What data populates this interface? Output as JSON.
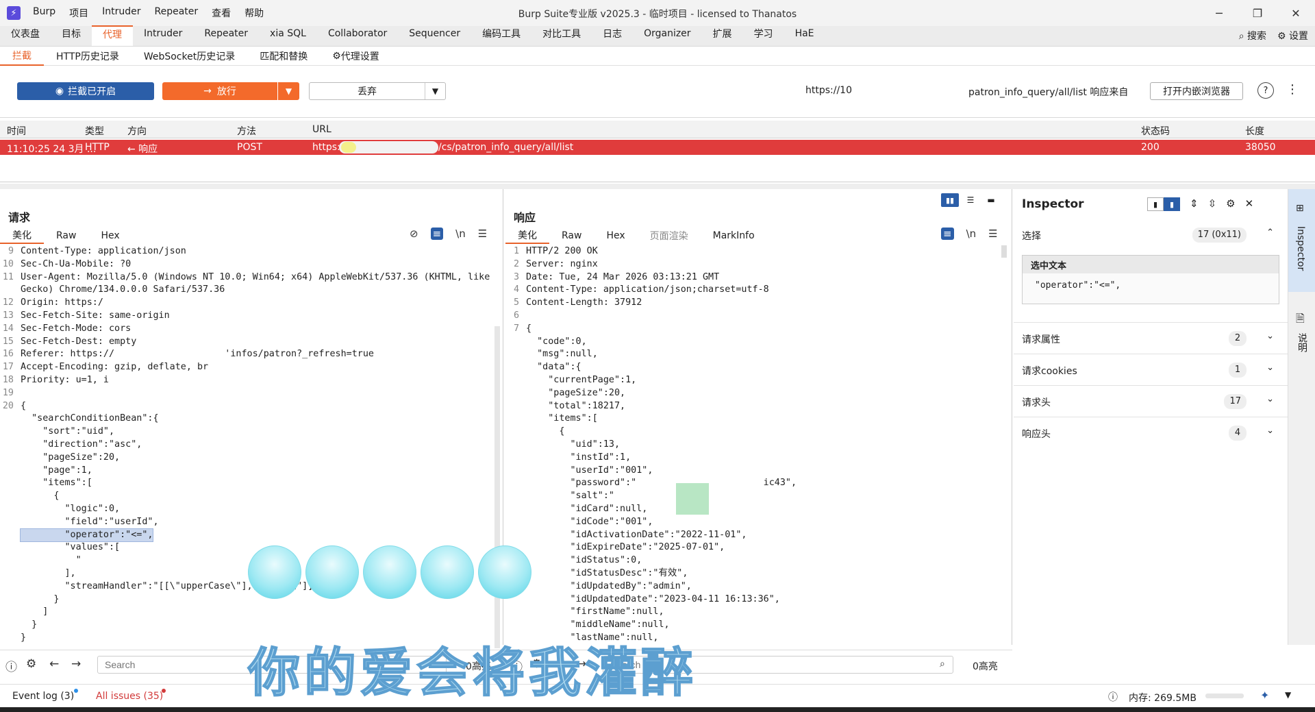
{
  "window": {
    "title": "Burp Suite专业版  v2025.3 - 临时项目 - licensed to Thanatos",
    "menu": [
      "Burp",
      "项目",
      "Intruder",
      "Repeater",
      "查看",
      "帮助"
    ],
    "controls": [
      "─",
      "❐",
      "✕"
    ]
  },
  "main_tabs": [
    "仪表盘",
    "目标",
    "代理",
    "Intruder",
    "Repeater",
    "xia SQL",
    "Collaborator",
    "Sequencer",
    "编码工具",
    "对比工具",
    "日志",
    "Organizer",
    "扩展",
    "学习",
    "HaE"
  ],
  "main_tab_active": "代理",
  "top_right": {
    "search": "搜索",
    "settings": "设置"
  },
  "sub_tabs": [
    "拦截",
    "HTTP历史记录",
    "WebSocket历史记录",
    "匹配和替换",
    "代理设置"
  ],
  "toolbar": {
    "intercept": "拦截已开启",
    "forward": "放行",
    "drop": "丢弃",
    "url": "https://10",
    "response_from": "patron_info_query/all/list 响应来自",
    "open_browser": "打开内嵌浏览器",
    "help": "?",
    "more": "⋮"
  },
  "table": {
    "headers": [
      "时间",
      "类型",
      "方向",
      "方法",
      "URL",
      "状态码",
      "长度"
    ],
    "row": {
      "time": "11:10:25 24 3月 ...",
      "type": "HTTP",
      "direction": "← 响应",
      "method": "POST",
      "url_prefix": "https:/",
      "url_suffix": "/cs/patron_info_query/all/list",
      "status": "200",
      "length": "38050"
    }
  },
  "request": {
    "title": "请求",
    "tabs": [
      "美化",
      "Raw",
      "Hex"
    ],
    "lines": [
      {
        "n": "9",
        "t": "Content-Type: application/json"
      },
      {
        "n": "10",
        "t": "Sec-Ch-Ua-Mobile: ?0"
      },
      {
        "n": "11",
        "t": "User-Agent: Mozilla/5.0 (Windows NT 10.0; Win64; x64) AppleWebKit/537.36 (KHTML, like"
      },
      {
        "n": "",
        "t": "Gecko) Chrome/134.0.0.0 Safari/537.36"
      },
      {
        "n": "12",
        "t": "Origin: https:/"
      },
      {
        "n": "13",
        "t": "Sec-Fetch-Site: same-origin"
      },
      {
        "n": "14",
        "t": "Sec-Fetch-Mode: cors"
      },
      {
        "n": "15",
        "t": "Sec-Fetch-Dest: empty"
      },
      {
        "n": "16",
        "t": "Referer: https://                    'infos/patron?_refresh=true"
      },
      {
        "n": "17",
        "t": "Accept-Encoding: gzip, deflate, br"
      },
      {
        "n": "18",
        "t": "Priority: u=1, i"
      },
      {
        "n": "19",
        "t": ""
      },
      {
        "n": "20",
        "t": "{"
      },
      {
        "n": "",
        "t": "  \"searchConditionBean\":{"
      },
      {
        "n": "",
        "t": "    \"sort\":\"uid\","
      },
      {
        "n": "",
        "t": "    \"direction\":\"asc\","
      },
      {
        "n": "",
        "t": "    \"pageSize\":20,"
      },
      {
        "n": "",
        "t": "    \"page\":1,"
      },
      {
        "n": "",
        "t": "    \"items\":["
      },
      {
        "n": "",
        "t": "      {"
      },
      {
        "n": "",
        "t": "        \"logic\":0,"
      },
      {
        "n": "",
        "t": "        \"field\":\"userId\","
      },
      {
        "n": "",
        "t": "        \"operator\":\"<=\","
      },
      {
        "n": "",
        "t": "        \"values\":["
      },
      {
        "n": "",
        "t": "          \""
      },
      {
        "n": "",
        "t": "        ],"
      },
      {
        "n": "",
        "t": "        \"streamHandler\":\"[[\\\"upperCase\\\"],[\\\"trim\\\"]]\""
      },
      {
        "n": "",
        "t": "      }"
      },
      {
        "n": "",
        "t": "    ]"
      },
      {
        "n": "",
        "t": "  }"
      },
      {
        "n": "",
        "t": "}"
      }
    ]
  },
  "response": {
    "title": "响应",
    "tabs": [
      "美化",
      "Raw",
      "Hex",
      "页面渲染",
      "MarkInfo"
    ],
    "lines": [
      {
        "n": "1",
        "t": "HTTP/2 200 OK"
      },
      {
        "n": "2",
        "t": "Server: nginx"
      },
      {
        "n": "3",
        "t": "Date: Tue, 24 Mar 2026 03:13:21 GMT"
      },
      {
        "n": "4",
        "t": "Content-Type: application/json;charset=utf-8"
      },
      {
        "n": "5",
        "t": "Content-Length: 37912"
      },
      {
        "n": "6",
        "t": ""
      },
      {
        "n": "7",
        "t": "{"
      },
      {
        "n": "",
        "t": "  \"code\":0,"
      },
      {
        "n": "",
        "t": "  \"msg\":null,"
      },
      {
        "n": "",
        "t": "  \"data\":{"
      },
      {
        "n": "",
        "t": "    \"currentPage\":1,"
      },
      {
        "n": "",
        "t": "    \"pageSize\":20,"
      },
      {
        "n": "",
        "t": "    \"total\":18217,"
      },
      {
        "n": "",
        "t": "    \"items\":["
      },
      {
        "n": "",
        "t": "      {"
      },
      {
        "n": "",
        "t": "        \"uid\":13,"
      },
      {
        "n": "",
        "t": "        \"instId\":1,"
      },
      {
        "n": "",
        "t": "        \"userId\":\"001\","
      },
      {
        "n": "",
        "t": "        \"password\":\"                       ic43\","
      },
      {
        "n": "",
        "t": "        \"salt\":\""
      },
      {
        "n": "",
        "t": "        \"idCard\":null,"
      },
      {
        "n": "",
        "t": "        \"idCode\":\"001\","
      },
      {
        "n": "",
        "t": "        \"idActivationDate\":\"2022-11-01\","
      },
      {
        "n": "",
        "t": "        \"idExpireDate\":\"2025-07-01\","
      },
      {
        "n": "",
        "t": "        \"idStatus\":0,"
      },
      {
        "n": "",
        "t": "        \"idStatusDesc\":\"有效\","
      },
      {
        "n": "",
        "t": "        \"idUpdatedBy\":\"admin\","
      },
      {
        "n": "",
        "t": "        \"idUpdatedDate\":\"2023-04-11 16:13:36\","
      },
      {
        "n": "",
        "t": "        \"firstName\":null,"
      },
      {
        "n": "",
        "t": "        \"middleName\":null,"
      },
      {
        "n": "",
        "t": "        \"lastName\":null,"
      }
    ]
  },
  "inspector": {
    "title": "Inspector",
    "selection_label": "选择",
    "selection_count": "17 (0x11)",
    "selected_text_label": "选中文本",
    "selected_text": "\"operator\":\"<=\",",
    "sections": [
      {
        "label": "请求属性",
        "count": "2"
      },
      {
        "label": "请求cookies",
        "count": "1"
      },
      {
        "label": "请求头",
        "count": "17"
      },
      {
        "label": "响应头",
        "count": "4"
      }
    ]
  },
  "side_tabs": [
    "Inspector",
    "说明"
  ],
  "search": {
    "placeholder": "Search",
    "req_count": "0高亮",
    "resp_count": "0高亮"
  },
  "status": {
    "event_log": "Event log (3)",
    "all_issues": "All issues (35)",
    "memory": "内存: 269.5MB"
  },
  "overlay_text": "你的爱会将我灌醉",
  "colors": {
    "accent": "#e8622a",
    "intercept_btn": "#2b5ea8",
    "forward_btn": "#f36a2b",
    "selected_row": "#e03c3c"
  }
}
